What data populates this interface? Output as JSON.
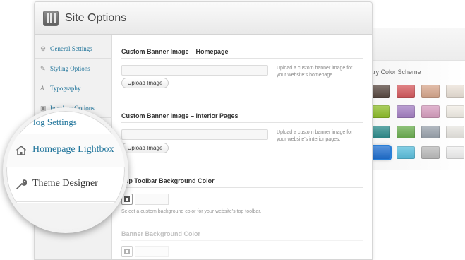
{
  "window": {
    "title": "Site Options",
    "icon": "settings-panel-icon"
  },
  "sidebar": {
    "items": [
      {
        "label": "General Settings",
        "icon": "gear-icon"
      },
      {
        "label": "Styling Options",
        "icon": "brush-icon"
      },
      {
        "label": "Typography",
        "icon": "font-icon"
      },
      {
        "label": "Interface Options",
        "icon": "window-icon"
      }
    ]
  },
  "magnifier": {
    "partial_label": "log Settings",
    "items": [
      {
        "label": "Homepage Lightbox",
        "icon": "home-icon"
      },
      {
        "label": "Theme Designer",
        "icon": "wrench-icon"
      }
    ]
  },
  "content": {
    "banner_home": {
      "title": "Custom Banner Image – Homepage",
      "button": "Upload Image",
      "help": "Upload a custom banner image for your website's homepage."
    },
    "banner_interior": {
      "title": "Custom Banner Image – Interior Pages",
      "button": "Upload Image",
      "help": "Upload a custom banner image for your website's interior pages."
    },
    "toolbar_bg": {
      "title": "Top Toolbar Background Color",
      "help": "Select a custom background color for your website's top toolbar."
    },
    "banner_bg": {
      "title": "Banner Background Color"
    }
  },
  "color_scheme": {
    "title": "rimary Color Scheme",
    "swatches": [
      "#5a4a42",
      "#d65a5e",
      "#d9a88e",
      "#ece3d9",
      "#8fbf2a",
      "#a580c4",
      "#d89ec0",
      "#f3efe7",
      "#2c8c8c",
      "#6aae4f",
      "#9aa3ad",
      "#e9e7e2",
      "#1f6fd0",
      "#5bc0de",
      "#bcbcbc",
      "#f1f1f1"
    ]
  }
}
